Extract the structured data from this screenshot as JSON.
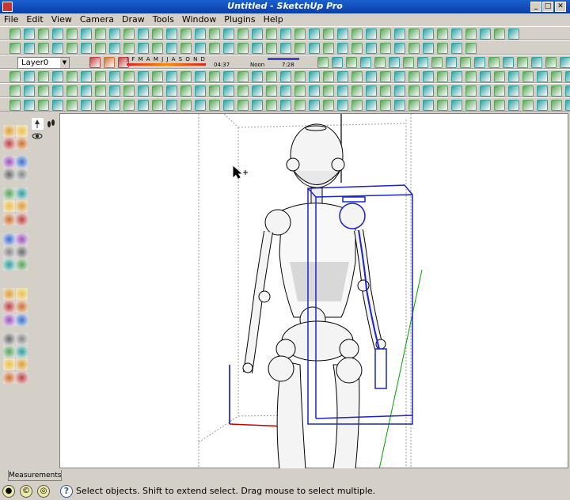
{
  "window": {
    "title": "Untitled - SketchUp Pro"
  },
  "menu": [
    "File",
    "Edit",
    "View",
    "Camera",
    "Draw",
    "Tools",
    "Window",
    "Plugins",
    "Help"
  ],
  "layer": {
    "selected": "Layer0"
  },
  "shadow": {
    "months": "J F M A M J J A S O N D",
    "time_start": "04:37",
    "time_mid": "Noon",
    "time_end": "7:28"
  },
  "measurements": {
    "label": "Measurements"
  },
  "status": {
    "help_icon": "?",
    "message": "Select objects. Shift to extend select. Drag mouse to select multiple."
  },
  "colors": {
    "title_blue": "#0a3ea8",
    "selection_blue": "#1a24c8",
    "axis_red": "#c00000",
    "axis_green": "#00a000",
    "axis_blue": "#0000c0"
  }
}
